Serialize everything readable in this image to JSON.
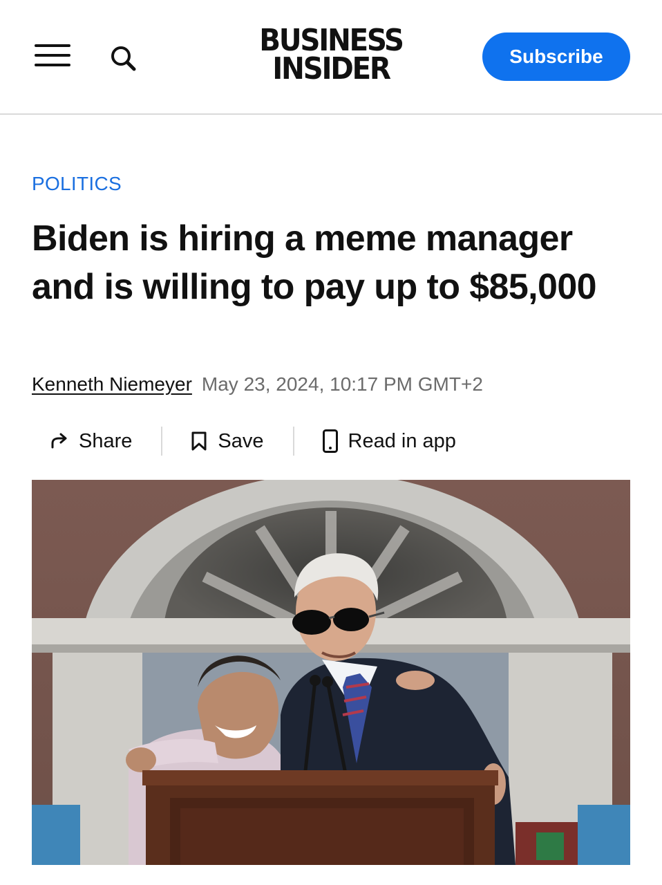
{
  "header": {
    "logo_line1": "BUSINESS",
    "logo_line2": "INSIDER",
    "subscribe_label": "Subscribe",
    "icons": [
      "hamburger-menu-icon",
      "search-icon"
    ]
  },
  "article": {
    "category": "POLITICS",
    "headline": "Biden is hiring a meme manager and is willing to pay up to $85,000",
    "author": "Kenneth Niemeyer",
    "date": "May 23, 2024, 10:17 PM GMT+2"
  },
  "actions": {
    "share_label": "Share",
    "save_label": "Save",
    "read_in_app_label": "Read in app",
    "icons": [
      "share-arrow-icon",
      "bookmark-icon",
      "phone-icon"
    ]
  },
  "colors": {
    "accent_blue": "#0f72ee",
    "category_blue": "#1a6fe0",
    "text": "#111111",
    "muted": "#6b6b6b",
    "divider": "#d9d9d9"
  }
}
